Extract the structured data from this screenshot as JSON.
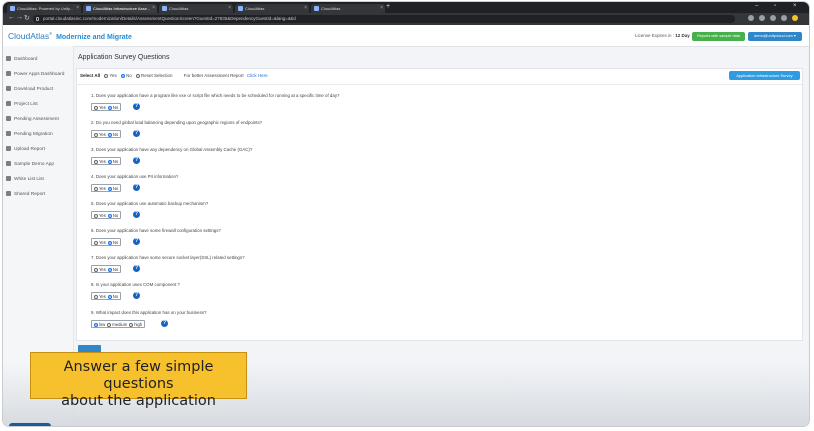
{
  "browser": {
    "tabs": [
      {
        "label": "CloudAtlas: Powered by Unify..."
      },
      {
        "label": "CloudAtlas Infrastructure Asse..."
      },
      {
        "label": "CloudAtlas"
      },
      {
        "label": "CloudAtlas"
      },
      {
        "label": "CloudAtlas"
      }
    ],
    "url": "portal.cloudatlasinc.com/modernization/Details/AssessmentQuestionScreen?GuestId=27835&DependencyGuestId=&lang=&tid"
  },
  "header": {
    "logo_main": "CloudAtlas",
    "logo_tm": "®",
    "logo_sub": "Modernize and Migrate",
    "license_label": "License Expires in :",
    "license_value": "12 Day",
    "reports_button": "Reports with sample data",
    "user_button": "demo@unifycloud.com ▾"
  },
  "sidebar": {
    "items": [
      {
        "label": "Dashboard"
      },
      {
        "label": "Power Apps Dashboard"
      },
      {
        "label": "Download Product"
      },
      {
        "label": "Project List"
      },
      {
        "label": "Pending Assessment"
      },
      {
        "label": "Pending Migration"
      },
      {
        "label": "Upload Report"
      },
      {
        "label": "Sample Demo App"
      },
      {
        "label": "White List List"
      },
      {
        "label": "Shared Report"
      }
    ]
  },
  "main": {
    "title": "Application Survey Questions",
    "select_all_label": "Select All",
    "yes_label": "Yes",
    "no_label": "No",
    "reset_label": "Reset Selection",
    "report_prefix": "For better Assessment Report",
    "report_link": "Click Here",
    "infra_button": "Application Infrastructure Survey",
    "questions": [
      {
        "text": "1. Does your application have a program like exe or script file which needs to be scheduled for running at a specific time of day?",
        "options": [
          "Yes",
          "No"
        ]
      },
      {
        "text": "2. Do you need global load balancing depending upon geographic regions of endpoints?",
        "options": [
          "Yes",
          "No"
        ]
      },
      {
        "text": "3. Does your application have any dependency on Global Assembly Cache (GAC)?",
        "options": [
          "Yes",
          "No"
        ]
      },
      {
        "text": "4. Does your application use PII information?",
        "options": [
          "Yes",
          "No"
        ]
      },
      {
        "text": "5. Does your application use automatic backup mechanism?",
        "options": [
          "Yes",
          "No"
        ]
      },
      {
        "text": "6. Does your application have some firewall configuration settings?",
        "options": [
          "Yes",
          "No"
        ]
      },
      {
        "text": "7. Does your application have some secure socket layer(SSL) related settings?",
        "options": [
          "Yes",
          "No"
        ]
      },
      {
        "text": "8. Is your application uses COM component ?",
        "options": [
          "Yes",
          "No"
        ]
      },
      {
        "text": "9. What impact does this application has on your business?",
        "options": [
          "low",
          "medium",
          "high"
        ]
      }
    ],
    "help_glyph": "?"
  },
  "callout": {
    "line1": "Answer a few simple questions",
    "line2": "about the application"
  }
}
